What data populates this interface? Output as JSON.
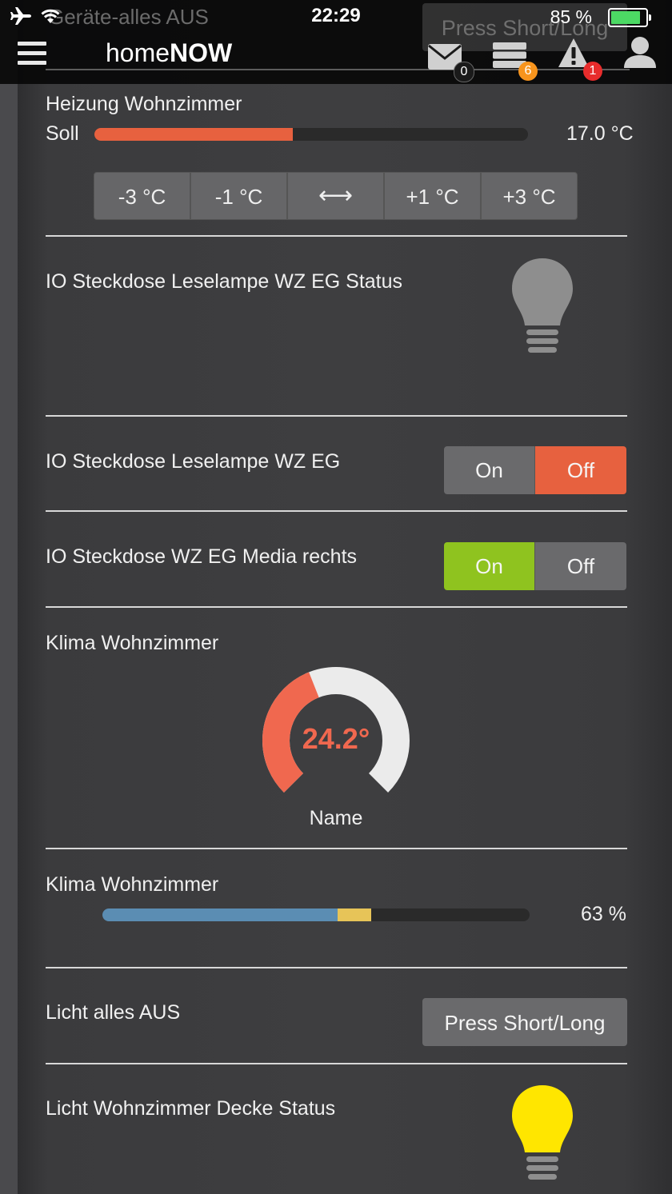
{
  "status_bar": {
    "time": "22:29",
    "battery": "85 %"
  },
  "header": {
    "logo_light": "home",
    "logo_bold": "NOW",
    "badges": {
      "messages": "0",
      "servers": "6",
      "alerts": "1"
    },
    "ghost_text": "Geräte-alles AUS",
    "ghost_button": "Press Short/Long"
  },
  "heating": {
    "title": "Heizung Wohnzimmer",
    "soll_label": "Soll",
    "value": "17.0 °C",
    "level_fraction": 0.46,
    "buttons": [
      "-3 °C",
      "-1 °C",
      "⟷",
      "+1 °C",
      "+3 °C"
    ]
  },
  "lamp_status": {
    "title": "IO Steckdose Leselampe WZ EG Status",
    "state": "off",
    "color": "#8e8e8e"
  },
  "switch1": {
    "title": "IO Steckdose Leselampe WZ EG",
    "on_label": "On",
    "off_label": "Off",
    "active": "off"
  },
  "switch2": {
    "title": "IO Steckdose WZ EG Media rechts",
    "on_label": "On",
    "off_label": "Off",
    "active": "on"
  },
  "climate_gauge": {
    "title": "Klima Wohnzimmer",
    "value": "24.2°",
    "name": "Name",
    "fill_fraction": 0.42
  },
  "climate_bar": {
    "title": "Klima Wohnzimmer",
    "value": "63 %",
    "blue_fraction": 0.55,
    "yellow_fraction": 0.08
  },
  "light_off": {
    "title": "Licht alles AUS",
    "button": "Press Short/Long"
  },
  "ceiling_status": {
    "title": "Licht Wohnzimmer Decke Status",
    "state": "on",
    "color": "#ffe600"
  },
  "colors": {
    "accent_red": "#e7613f",
    "accent_green": "#8fc31f",
    "bar_blue": "#5b8db3",
    "bar_yellow": "#e7c458"
  }
}
